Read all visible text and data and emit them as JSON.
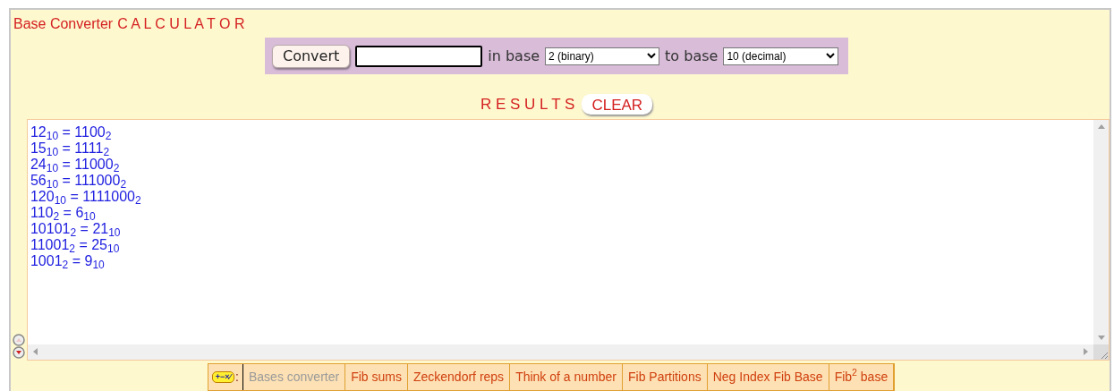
{
  "title": {
    "name": "Base Converter",
    "label": "C A L C U L A T O R"
  },
  "form": {
    "button": "Convert",
    "in_label": "in base",
    "from_base": "2 (binary)",
    "to_label": "to base",
    "to_base": "10 (decimal)"
  },
  "results": {
    "label": "R E S U L T S",
    "clear": "CLEAR",
    "lines": [
      "12$_{10}$ = 1100$_{2}$",
      "15$_{10}$ = 1111$_{2}$",
      "24$_{10}$ = 11000$_{2}$",
      "56$_{10}$ = 111000$_{2}$",
      "120$_{10}$ = 1111000$_{2}$",
      "110$_{2}$ = 6$_{10}$",
      "10101$_{2}$ = 21$_{10}$",
      "11001$_{2}$ = 25$_{10}$",
      "1001$_{2}$ = 9$_{10}$"
    ]
  },
  "nav": {
    "badge": "+−×⁄",
    "colon": ":",
    "tabs": [
      {
        "label": "Bases converter",
        "selected": true
      },
      {
        "label": "Fib sums",
        "selected": false
      },
      {
        "label": "Zeckendorf reps",
        "selected": false
      },
      {
        "label": "Think of a number",
        "selected": false
      },
      {
        "label": "Fib Partitions",
        "selected": false
      },
      {
        "label": "Neg Index Fib Base",
        "selected": false
      },
      {
        "label": "Fib$^{2}$ base",
        "selected": false
      }
    ]
  }
}
